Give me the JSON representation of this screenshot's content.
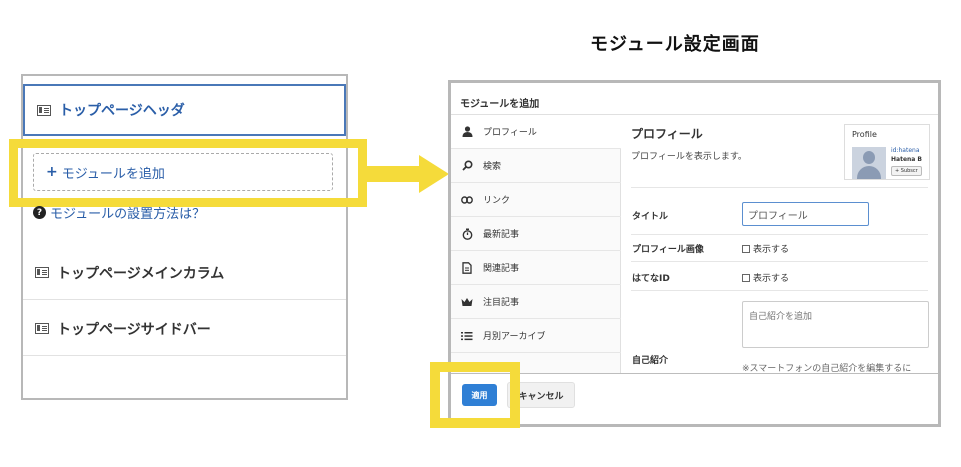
{
  "heading": "モジュール設定画面",
  "left_panel": {
    "modules": [
      {
        "label": "トップページヘッダ"
      },
      {
        "label": "トップページメインカラム"
      },
      {
        "label": "トップページサイドバー"
      }
    ],
    "add_module": {
      "plus": "+",
      "label": "モジュールを追加"
    },
    "help_link": {
      "icon": "?",
      "label": "モジュールの設置方法は？"
    }
  },
  "dialog": {
    "title": "モジュールを追加",
    "sidebar_items": [
      {
        "icon": "person-icon",
        "label": "プロフィール"
      },
      {
        "icon": "search-icon",
        "label": "検索"
      },
      {
        "icon": "link-icon",
        "label": "リンク"
      },
      {
        "icon": "stopwatch-icon",
        "label": "最新記事"
      },
      {
        "icon": "document-icon",
        "label": "関連記事"
      },
      {
        "icon": "crown-icon",
        "label": "注目記事"
      },
      {
        "icon": "list-icon",
        "label": "月別アーカイブ"
      }
    ],
    "content": {
      "title": "プロフィール",
      "description": "プロフィールを表示します。",
      "preview": {
        "label": "Profile",
        "id_text": "id:hatena",
        "name": "Hatena B",
        "subscribe": "+ Subscr"
      },
      "fields": {
        "title_label": "タイトル",
        "title_value": "プロフィール",
        "image_label": "プロフィール画像",
        "image_option": "表示する",
        "hatena_id_label": "はてなID",
        "hatena_id_option": "表示する",
        "bio_label": "自己紹介",
        "bio_placeholder": "自己紹介を追加",
        "bio_note": "※スマートフォンの自己紹介を編集するに"
      }
    },
    "buttons": {
      "apply": "適用",
      "cancel": "キャンセル"
    }
  },
  "colors": {
    "highlight": "#f5db3a",
    "link": "#2a5ea8",
    "primary_button": "#2f7fd5"
  }
}
